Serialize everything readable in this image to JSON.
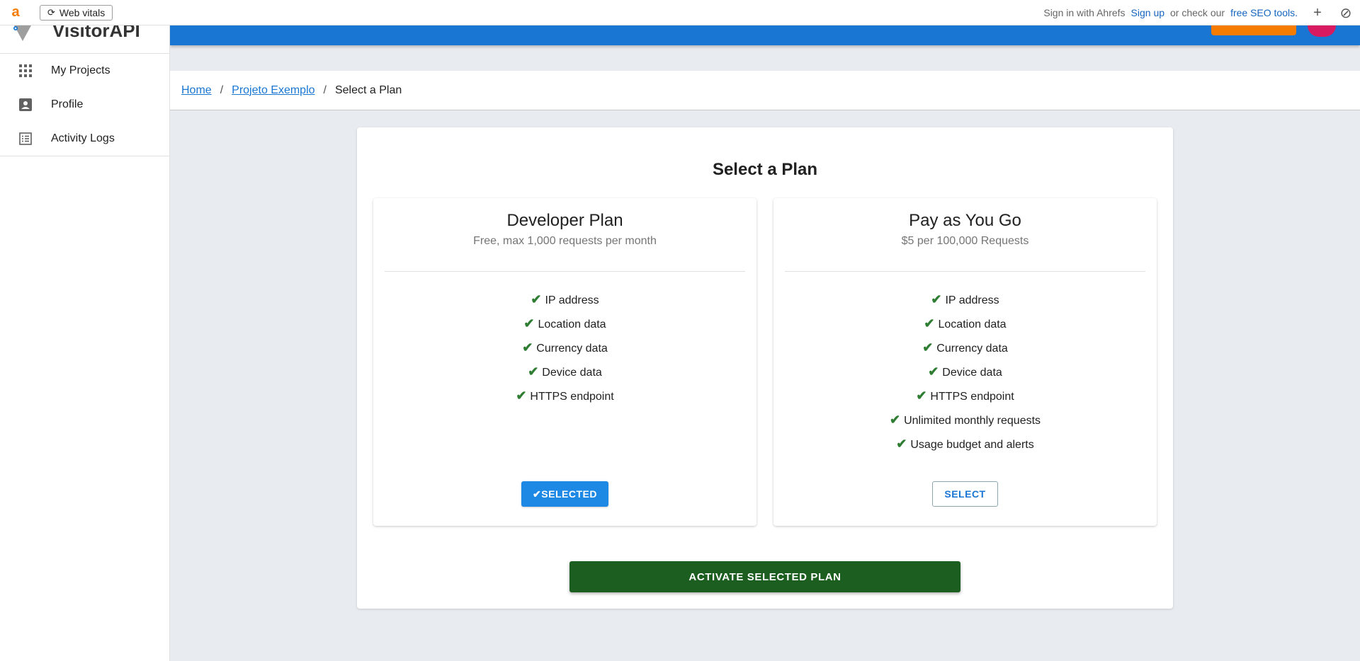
{
  "extension": {
    "logo": "a",
    "web_vitals": "Web vitals",
    "sign_in": "Sign in with Ahrefs",
    "sign_up": "Sign up",
    "or_check": "or check our",
    "free_tools": "free SEO tools."
  },
  "brand": {
    "name": "VisitorAPI"
  },
  "sidebar": {
    "items": [
      {
        "label": "My Projects",
        "icon": "grid-icon"
      },
      {
        "label": "Profile",
        "icon": "account-box-icon"
      },
      {
        "label": "Activity Logs",
        "icon": "list-icon"
      }
    ]
  },
  "breadcrumb": {
    "home": "Home",
    "project": "Projeto Exemplo",
    "current": "Select a Plan"
  },
  "page": {
    "title": "Select a Plan"
  },
  "plans": [
    {
      "name": "Developer Plan",
      "price": "Free, max 1,000 requests per month",
      "features": [
        "IP address",
        "Location data",
        "Currency data",
        "Device data",
        "HTTPS endpoint"
      ],
      "button": "SELECTED",
      "selected": true
    },
    {
      "name": "Pay as You Go",
      "price": "$5 per 100,000 Requests",
      "features": [
        "IP address",
        "Location data",
        "Currency data",
        "Device data",
        "HTTPS endpoint",
        "Unlimited monthly requests",
        "Usage budget and alerts"
      ],
      "button": "SELECT",
      "selected": false
    }
  ],
  "activate": {
    "label": "ACTIVATE SELECTED PLAN"
  },
  "colors": {
    "primary": "#1976d2",
    "activate": "#1b5e20",
    "check": "#2e7d32",
    "accent_orange": "#f57c00"
  }
}
